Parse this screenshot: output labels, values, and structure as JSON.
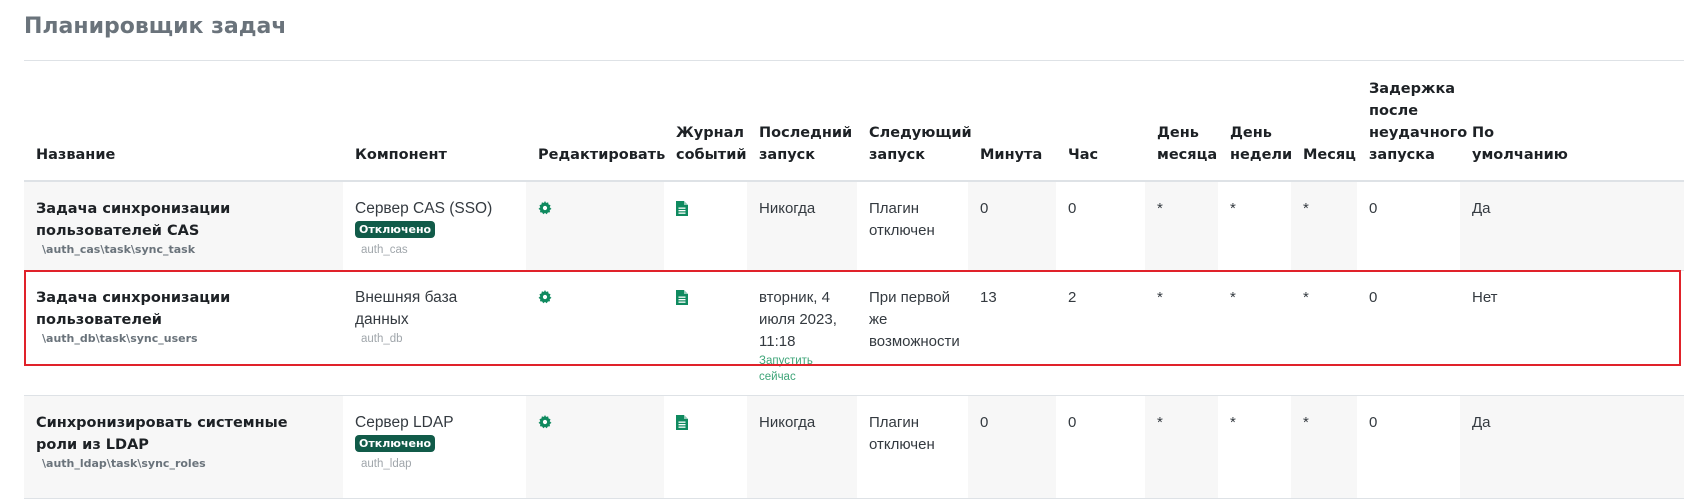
{
  "page": {
    "title": "Планировщик задач"
  },
  "colors": {
    "title": "#6a737b",
    "badge_bg": "#115b49",
    "icon_green": "#0f8a5f",
    "run_now": "#3fa579",
    "highlight_border": "#e0222a"
  },
  "table": {
    "headers": {
      "name": "Название",
      "component": "Компонент",
      "edit": "Редактировать",
      "log": "Журнал событий",
      "last_run": "Последний запуск",
      "next_run": "Следующий запуск",
      "minute": "Минута",
      "hour": "Час",
      "day_of_month": "День месяца",
      "day_of_week": "День недели",
      "month": "Месяц",
      "fail_delay": "Задержка после неудачного запуска",
      "default": "По умолчанию"
    },
    "rows": [
      {
        "name": "Задача синхронизации пользователей CAS",
        "classname": "\\auth_cas\\task\\sync_task",
        "component": "Сервер CAS (SSO)",
        "component_badge": "Отключено",
        "component_code": "auth_cas",
        "edit_icon": "gear-icon",
        "log_icon": "document-icon",
        "last_run": "Никогда",
        "next_run": "Плагин отключен",
        "minute": "0",
        "hour": "0",
        "day_of_month": "*",
        "day_of_week": "*",
        "month": "*",
        "fail_delay": "0",
        "default": "Да"
      },
      {
        "name": "Задача синхронизации пользователей",
        "classname": "\\auth_db\\task\\sync_users",
        "component": "Внешняя база данных",
        "component_code": "auth_db",
        "edit_icon": "gear-icon",
        "log_icon": "document-icon",
        "last_run": "вторник, 4 июля 2023, 11:18",
        "run_now": "Запустить сейчас",
        "next_run": "При первой же возможности",
        "minute": "13",
        "hour": "2",
        "day_of_month": "*",
        "day_of_week": "*",
        "month": "*",
        "fail_delay": "0",
        "default": "Нет"
      },
      {
        "name": "Синхронизировать системные роли из LDAP",
        "classname": "\\auth_ldap\\task\\sync_roles",
        "component": "Сервер LDAP",
        "component_badge": "Отключено",
        "component_code": "auth_ldap",
        "edit_icon": "gear-icon",
        "log_icon": "document-icon",
        "last_run": "Никогда",
        "next_run": "Плагин отключен",
        "minute": "0",
        "hour": "0",
        "day_of_month": "*",
        "day_of_week": "*",
        "month": "*",
        "fail_delay": "0",
        "default": "Да"
      }
    ]
  }
}
